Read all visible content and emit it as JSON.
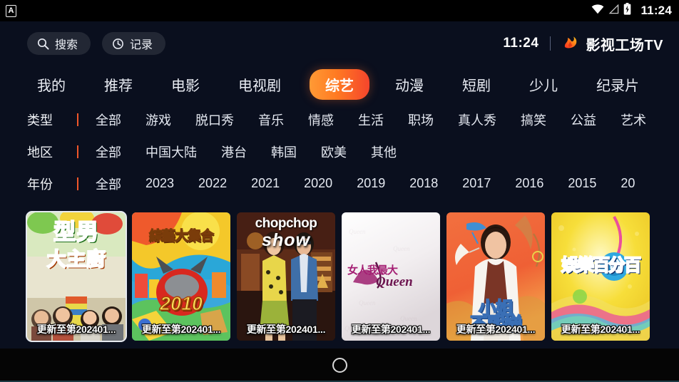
{
  "statusbar": {
    "app_badge": "A",
    "time": "11:24",
    "icons": [
      "wifi-icon",
      "signal-icon",
      "battery-charging-icon"
    ]
  },
  "toolbar": {
    "search_label": "搜索",
    "search_icon": "search-icon",
    "history_label": "记录",
    "history_icon": "clock-icon",
    "time": "11:24",
    "brand_name": "影视工场TV",
    "brand_icon": "flame-logo-icon"
  },
  "nav": {
    "items": [
      {
        "label": "我的",
        "active": false
      },
      {
        "label": "推荐",
        "active": false
      },
      {
        "label": "电影",
        "active": false
      },
      {
        "label": "电视剧",
        "active": false
      },
      {
        "label": "综艺",
        "active": true
      },
      {
        "label": "动漫",
        "active": false
      },
      {
        "label": "短剧",
        "active": false
      },
      {
        "label": "少儿",
        "active": false
      },
      {
        "label": "纪录片",
        "active": false
      }
    ]
  },
  "filters": {
    "type": {
      "label": "类型",
      "items": [
        "全部",
        "游戏",
        "脱口秀",
        "音乐",
        "情感",
        "生活",
        "职场",
        "真人秀",
        "搞笑",
        "公益",
        "艺术"
      ]
    },
    "region": {
      "label": "地区",
      "items": [
        "全部",
        "中国大陆",
        "港台",
        "韩国",
        "欧美",
        "其他"
      ]
    },
    "year": {
      "label": "年份",
      "items": [
        "全部",
        "2023",
        "2022",
        "2021",
        "2020",
        "2019",
        "2018",
        "2017",
        "2016",
        "2015",
        "20"
      ]
    }
  },
  "cards": [
    {
      "title": "型男大主廚",
      "art_line1": "型男",
      "art_line2": "大主廚",
      "caption": "更新至第202401...",
      "focused": true
    },
    {
      "title": "綜藝大集合",
      "art_line1": "綜藝大集合",
      "art_line2": "2010",
      "caption": "更新至第202401...",
      "focused": false
    },
    {
      "title": "chopchop show",
      "art_line1": "chopchop",
      "art_line2": "show",
      "caption": "更新至第202401...",
      "focused": false
    },
    {
      "title": "女人我最大 Queen",
      "art_line1": "女人我最大",
      "art_line2": "Queen",
      "caption": "更新至第202401...",
      "focused": false
    },
    {
      "title": "小姐不熙娣",
      "art_line1": "小姐",
      "art_line2": "不熙娣",
      "caption": "更新至第202401...",
      "focused": false
    },
    {
      "title": "娛樂百分百",
      "art_line1": "娛樂百分百",
      "art_line2": "",
      "caption": "更新至第202401...",
      "focused": false
    }
  ],
  "sysnav": {
    "home_icon": "home-circle-icon"
  },
  "colors": {
    "background": "#0a0f1e",
    "accent_start": "#ff9a35",
    "accent_end": "#f5452c",
    "separator": "#f0562a",
    "text": "#e9ecf3"
  }
}
